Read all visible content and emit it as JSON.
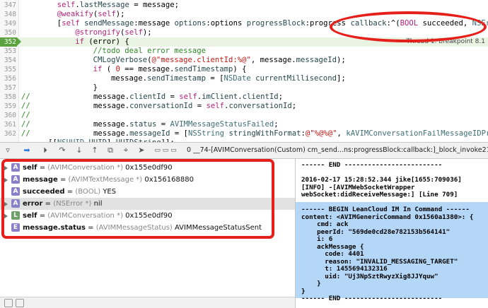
{
  "editor": {
    "lines": [
      {
        "n": "347",
        "indent": 8,
        "html": "<span class='k'>self</span>.<span class='m'>lastMessage</span> = message;"
      },
      {
        "n": "348",
        "indent": 8,
        "html": "<span class='k'>@weakify</span>(<span class='k'>self</span>);"
      },
      {
        "n": "349",
        "indent": 8,
        "html": "[<span class='k'>self</span> <span class='m'>sendMessage</span>:message <span class='m'>options</span>:options <span class='m'>progressBlock</span>:progress <span class='m'>callback</span>:^(<span class='k'>BOOL</span> succeeded, <span class='t'>NSError</span> *error) {"
      },
      {
        "n": "350",
        "indent": 12,
        "html": "<span class='k'>@strongify</span>(<span class='k'>self</span>);"
      },
      {
        "n": "352",
        "indent": 12,
        "html": "<span class='k'>if</span> (error) {"
      },
      {
        "n": "353",
        "indent": 16,
        "html": "<span class='cm'>//todo deal error message</span>"
      },
      {
        "n": "354",
        "indent": 16,
        "html": "<span class='m'>CMLogVerbose</span>(<span class='s'>@\"message.clientId:%@\"</span>, message.<span class='m'>messageId</span>);"
      },
      {
        "n": "355",
        "indent": 16,
        "html": "<span class='k'>if</span> ( <span class='s'>0</span> == message.<span class='m'>sendTimestamp</span>) {"
      },
      {
        "n": "356",
        "indent": 20,
        "html": "message.<span class='m'>sendTimestamp</span> = [<span class='t'>NSDate</span> <span class='m'>currentMillisecond</span>];"
      },
      {
        "n": "357",
        "indent": 16,
        "html": "}"
      },
      {
        "n": "358",
        "indent": 0,
        "html": "<span class='cm'>//</span>              message.<span class='m'>clientId</span> = <span class='k'>self</span>.<span class='m'>imClient</span>.<span class='m'>clientId</span>;"
      },
      {
        "n": "359",
        "indent": 0,
        "html": "<span class='cm'>//</span>              message.<span class='m'>conversationId</span> = <span class='k'>self</span>.<span class='m'>conversationId</span>;"
      },
      {
        "n": "360",
        "indent": 0,
        "html": "<span class='cm'>//</span>"
      },
      {
        "n": "361",
        "indent": 0,
        "html": "<span class='cm'>//</span>              message.<span class='m'>status</span> = <span class='t'>AVIMMessageStatusFailed</span>;"
      },
      {
        "n": "362",
        "indent": 0,
        "html": "<span class='cm'>//</span>              message.<span class='m'>messageId</span> = [<span class='t'>NSString</span> <span class='m'>stringWithFormat</span>:<span class='s'>@\"%@%@\"</span>, <span class='t'>kAVIMConversationFailMessageIDPrefix</span>,"
      },
      {
        "n": "",
        "indent": 6,
        "html": "[[<span class='t'>NSUUID</span> <span class='m'>UUID</span>] <span class='m'>UUIDString</span>]];"
      },
      {
        "n": "363",
        "indent": 0,
        "html": "<span class='cm'>//</span>              <span class='t'>NSMutableDictionary</span> *attrs = [<span class='t'>NSMutableDictionary</span> <span class='m'>dictionaryWithDictionary</span>:message.<span class='m'>attributes</span>?:@{}];"
      },
      {
        "n": "364",
        "indent": 0,
        "html": "<span class='cm'>//</span>              attrs[kAVIMConversationMessageErrorCode] = @(error.code);"
      }
    ],
    "thread_label": "Thread 1: breakpoint 8.1"
  },
  "toolbar": {
    "breadcrumb": "0 __74-[AVIMConversation(Custom) cm_send...ns:progressBlock:callback:]_block_invoke219"
  },
  "variables": [
    {
      "name": "self",
      "type": "(AVIMConversation *)",
      "value": "0x155e0df90",
      "badge": "A",
      "badge_color": "#8a7fc9",
      "expand": true
    },
    {
      "name": "message",
      "type": "(AVIMTextMessage *)",
      "value": "0x156168880",
      "badge": "A",
      "badge_color": "#8a7fc9",
      "expand": true
    },
    {
      "name": "succeeded",
      "type": "(BOOL)",
      "value": "YES",
      "badge": "A",
      "badge_color": "#8a7fc9",
      "expand": false
    },
    {
      "name": "error",
      "type": "(NSError *)",
      "value": "nil",
      "badge": "A",
      "badge_color": "#8a7fc9",
      "expand": true,
      "selected": true
    },
    {
      "name": "self",
      "type": "(AVIMConversation *)",
      "value": "0x155e0df90",
      "badge": "L",
      "badge_color": "#6fa06a",
      "expand": true
    },
    {
      "name": "message.status",
      "type": "(AVIMMessageStatus)",
      "value": "AVIMMessageStatusSent",
      "badge": "E",
      "badge_color": "#8a7fc9",
      "expand": false
    }
  ],
  "console": {
    "lines": [
      "------ END -------------------------",
      "",
      "2016-02-17 15:28:52.344 jike[1655:709036]",
      "[INFO] -[AVIMWebSocketWrapper",
      "webSocket:didReceiveMessage:] [Line 709]",
      "",
      "------ BEGIN LeanCloud IM In Command ------",
      "content: <AVIMGenericCommand 0x1560a1380>: {",
      "    cmd: ack",
      "    peerId: \"569de0cd28e782153b564141\"",
      "    i: 6",
      "    ackMessage {",
      "      code: 4401",
      "      reason: \"INVALID_MESSAGING_TARGET\"",
      "      t: 1455694132316",
      "      uid: \"Uj3NpSztRwyzXig8JJYquw\"",
      "    }",
      "}",
      "------ END -------------------------"
    ]
  }
}
